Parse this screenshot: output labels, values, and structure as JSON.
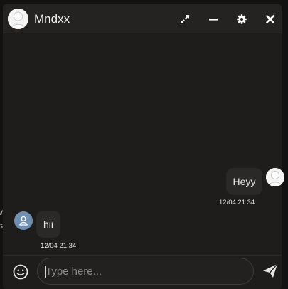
{
  "background": {
    "fragment_1": "ve",
    "fragment_2": "s"
  },
  "header": {
    "title": "Mndxx",
    "avatar_icon": "user-silhouette-icon",
    "buttons": [
      {
        "name": "expand",
        "icon": "expand-arrows-icon"
      },
      {
        "name": "minimize",
        "icon": "minus-icon"
      },
      {
        "name": "settings",
        "icon": "gear-icon"
      },
      {
        "name": "close",
        "icon": "close-x-icon"
      }
    ]
  },
  "messages": [
    {
      "direction": "outgoing",
      "text": "Heyy",
      "time": "12/04 21:34"
    },
    {
      "direction": "incoming",
      "text": "hii",
      "time": "12/04 21:34"
    }
  ],
  "composer": {
    "placeholder": "Type here...",
    "value": "",
    "emoji_icon": "smiley-icon",
    "send_icon": "paper-plane-icon"
  },
  "colors": {
    "window_bg": "#1e1d1c",
    "header_bg": "#242322",
    "bubble_bg": "#2a2928",
    "incoming_avatar": "#6f8fb3",
    "text": "#f2f2f2"
  }
}
